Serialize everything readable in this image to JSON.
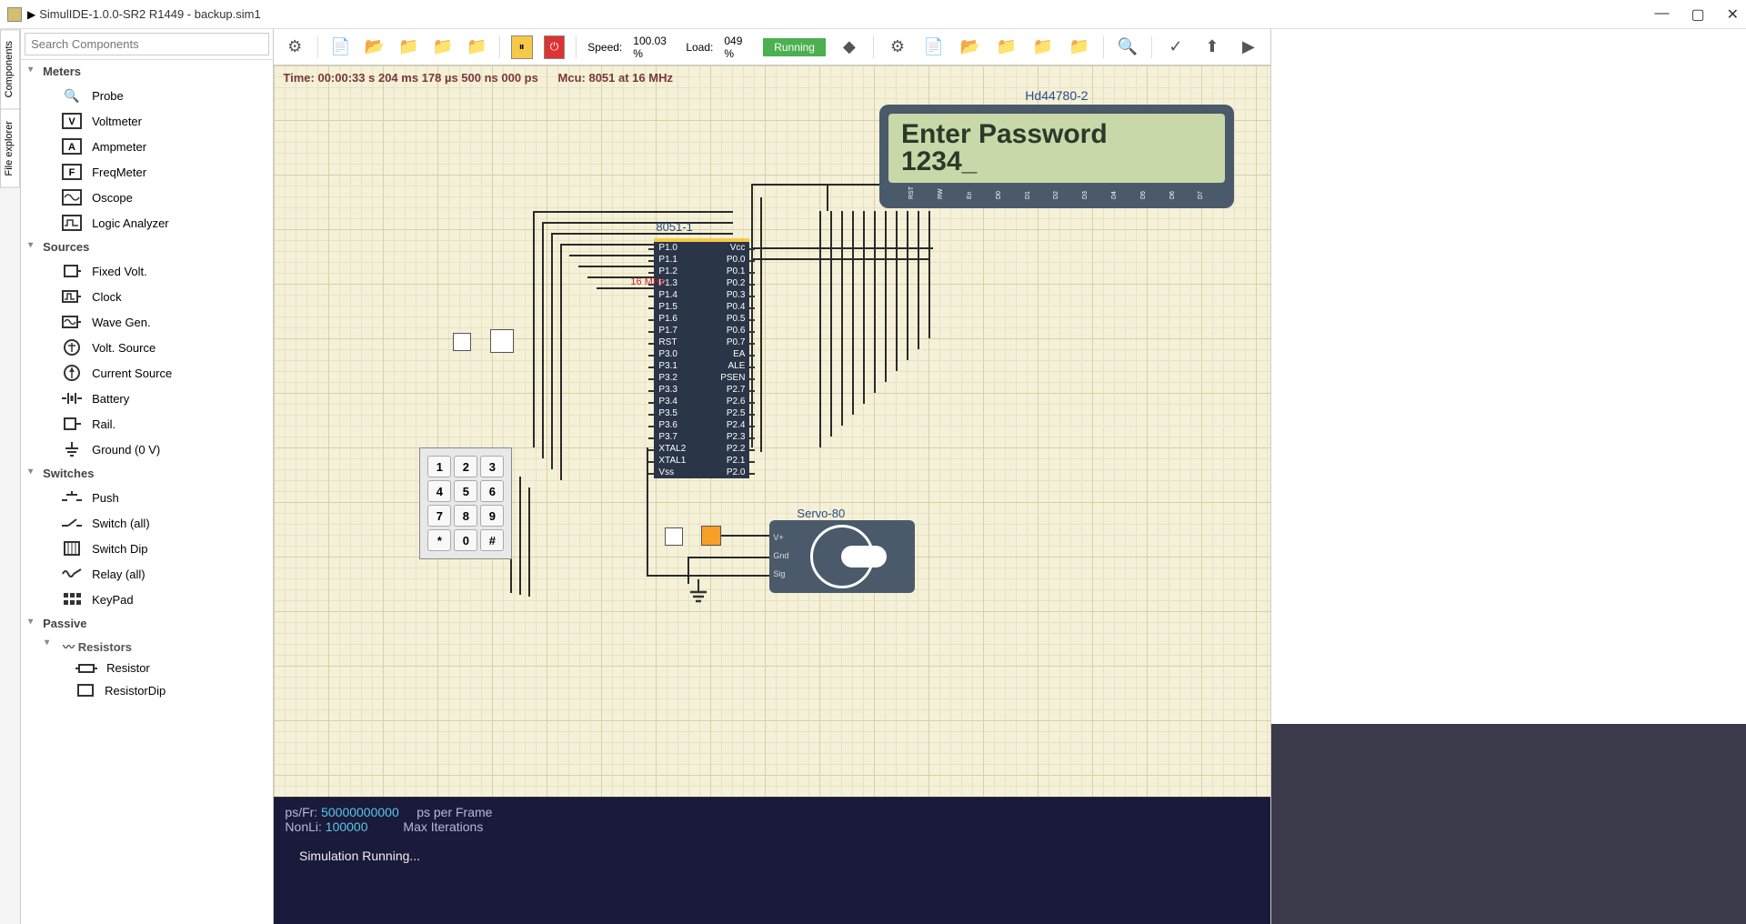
{
  "titlebar": {
    "title": "SimulIDE-1.0.0-SR2 R1449 - backup.sim1"
  },
  "search": {
    "placeholder": "Search Components"
  },
  "tree": {
    "cat_meters": "Meters",
    "probe": "Probe",
    "voltmeter": "Voltmeter",
    "ampmeter": "Ampmeter",
    "freqmeter": "FreqMeter",
    "oscope": "Oscope",
    "logic_analyzer": "Logic Analyzer",
    "cat_sources": "Sources",
    "fixed_volt": "Fixed Volt.",
    "clock": "Clock",
    "wave_gen": "Wave Gen.",
    "volt_source": "Volt. Source",
    "current_source": "Current Source",
    "battery": "Battery",
    "rail": "Rail.",
    "ground": "Ground (0 V)",
    "cat_switches": "Switches",
    "push": "Push",
    "switch_all": "Switch (all)",
    "switch_dip": "Switch Dip",
    "relay_all": "Relay (all)",
    "keypad": "KeyPad",
    "cat_passive": "Passive",
    "resistors": "Resistors",
    "resistor": "Resistor",
    "resistor_dip": "ResistorDip"
  },
  "vtabs": {
    "components": "Components",
    "file_explorer": "File explorer"
  },
  "toolbar": {
    "speed_label": "Speed:",
    "speed_value": "100.03 %",
    "load_label": "Load:",
    "load_value": "049 %",
    "running": "Running"
  },
  "timebar": {
    "time": "Time: 00:00:33 s  204 ms  178 µs  500 ns  000 ps",
    "mcu": "Mcu: 8051 at 16 MHz"
  },
  "lcd": {
    "label": "Hd44780-2",
    "line1": "Enter Password",
    "line2": "1234_",
    "pins": [
      "RST",
      "RW",
      "En",
      "D0",
      "D1",
      "D2",
      "D3",
      "D4",
      "D5",
      "D6",
      "D7"
    ]
  },
  "mcu": {
    "label": "8051-1",
    "freq": "16 MHz",
    "left_pins": [
      "P1.0",
      "P1.1",
      "P1.2",
      "P1.3",
      "P1.4",
      "P1.5",
      "P1.6",
      "P1.7",
      "RST",
      "P3.0",
      "P3.1",
      "P3.2",
      "P3.3",
      "P3.4",
      "P3.5",
      "P3.6",
      "P3.7",
      "XTAL2",
      "XTAL1",
      "Vss"
    ],
    "right_pins": [
      "Vcc",
      "P0.0",
      "P0.1",
      "P0.2",
      "P0.3",
      "P0.4",
      "P0.5",
      "P0.6",
      "P0.7",
      "EA",
      "ALE",
      "PSEN",
      "P2.7",
      "P2.6",
      "P2.5",
      "P2.4",
      "P2.3",
      "P2.2",
      "P2.1",
      "P2.0"
    ]
  },
  "keypad": {
    "keys": [
      "1",
      "2",
      "3",
      "4",
      "5",
      "6",
      "7",
      "8",
      "9",
      "*",
      "0",
      "#"
    ]
  },
  "servo": {
    "label": "Servo-80",
    "pins": [
      "V+",
      "Gnd",
      "Sig"
    ]
  },
  "console": {
    "psfr_label": "ps/Fr:",
    "psfr_val": "50000000000",
    "psfr_desc": "ps per Frame",
    "nonli_label": "NonLi:",
    "nonli_val": "100000",
    "nonli_desc": "Max Iterations",
    "running": "Simulation Running..."
  }
}
